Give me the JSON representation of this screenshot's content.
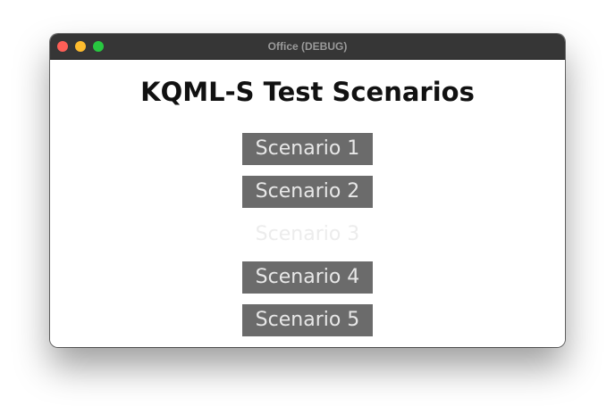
{
  "window": {
    "title": "Office (DEBUG)"
  },
  "main": {
    "heading": "KQML-S Test Scenarios",
    "scenarios": [
      {
        "label": "Scenario 1",
        "enabled": true
      },
      {
        "label": "Scenario 2",
        "enabled": true
      },
      {
        "label": "Scenario 3",
        "enabled": false
      },
      {
        "label": "Scenario 4",
        "enabled": true
      },
      {
        "label": "Scenario 5",
        "enabled": true
      }
    ]
  },
  "colors": {
    "button_bg": "#6b6b6b",
    "button_text": "#e8e8e8",
    "disabled_text": "#ececec",
    "titlebar": "#363636"
  }
}
